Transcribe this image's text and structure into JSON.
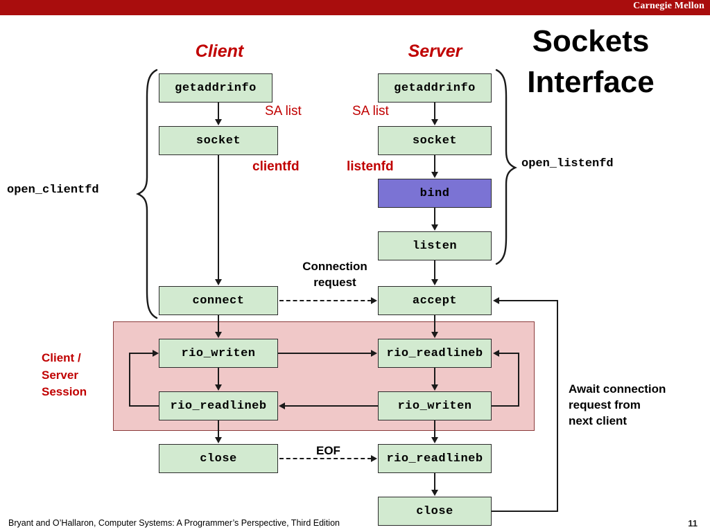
{
  "banner": {
    "institution": "Carnegie Mellon"
  },
  "slide": {
    "title_line1": "Sockets",
    "title_line2": "Interface",
    "page_number": "11",
    "footer": "Bryant and O’Hallaron, Computer Systems: A Programmer’s Perspective, Third Edition"
  },
  "columns": {
    "client_header": "Client",
    "server_header": "Server"
  },
  "client_flow": [
    {
      "label": "getaddrinfo",
      "color": "#d2ead0"
    },
    {
      "label": "socket",
      "color": "#d2ead0"
    },
    {
      "label": "connect",
      "color": "#d2ead0"
    },
    {
      "label": "rio_writen",
      "color": "#d2ead0"
    },
    {
      "label": "rio_readlineb",
      "color": "#d2ead0"
    },
    {
      "label": "close",
      "color": "#d2ead0"
    }
  ],
  "server_flow": [
    {
      "label": "getaddrinfo",
      "color": "#d2ead0"
    },
    {
      "label": "socket",
      "color": "#d2ead0"
    },
    {
      "label": "bind",
      "color": "#7b73d4"
    },
    {
      "label": "listen",
      "color": "#d2ead0"
    },
    {
      "label": "accept",
      "color": "#d2ead0"
    },
    {
      "label": "rio_readlineb",
      "color": "#d2ead0"
    },
    {
      "label": "rio_writen",
      "color": "#d2ead0"
    },
    {
      "label": "rio_readlineb",
      "color": "#d2ead0"
    },
    {
      "label": "close",
      "color": "#d2ead0"
    }
  ],
  "annotations": {
    "sa_list_client": "SA list",
    "sa_list_server": "SA list",
    "clientfd": "clientfd",
    "listenfd": "listenfd",
    "open_clientfd": "open_clientfd",
    "open_listenfd": "open_listenfd",
    "connection_request_l1": "Connection",
    "connection_request_l2": "request",
    "eof": "EOF",
    "session_l1": "Client /",
    "session_l2": "Server",
    "session_l3": "Session",
    "await_l1": "Await connection",
    "await_l2": "request from",
    "await_l3": "next client"
  },
  "colors": {
    "banner_red": "#a90d0d",
    "accent_red": "#c00000",
    "box_green": "#d2ead0",
    "box_purple": "#7b73d4",
    "session_pink": "#f0c8c8",
    "line_black": "#1a1a1a"
  }
}
